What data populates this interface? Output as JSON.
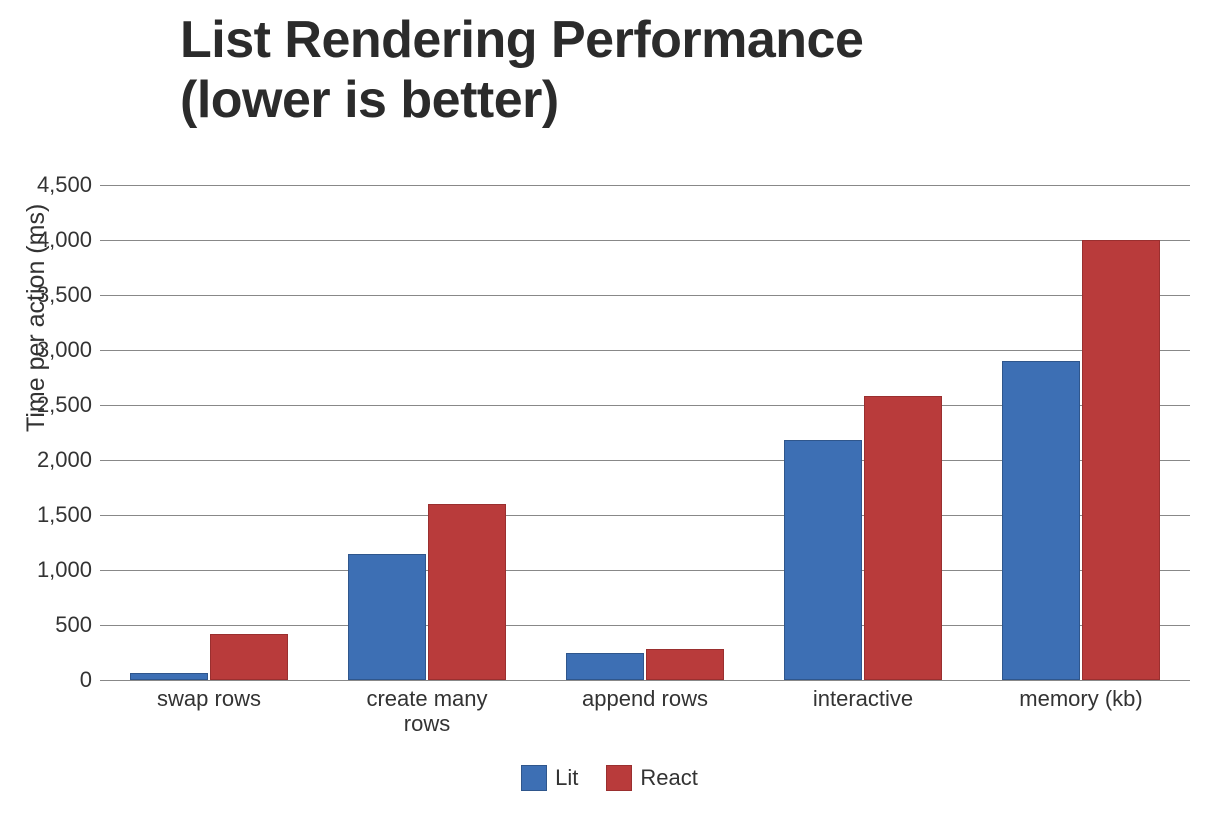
{
  "chart_data": {
    "type": "bar",
    "title_line1": "List Rendering Performance",
    "title_line2": "(lower is better)",
    "xlabel": "",
    "ylabel": "Time per action (ms)",
    "ylim": [
      0,
      4500
    ],
    "y_ticks": [
      0,
      500,
      1000,
      1500,
      2000,
      2500,
      3000,
      3500,
      4000,
      4500
    ],
    "y_tick_labels": [
      "0",
      "500",
      "1,000",
      "1,500",
      "2,000",
      "2,500",
      "3,000",
      "3,500",
      "4,000",
      "4,500"
    ],
    "categories": [
      "swap rows",
      "create many rows",
      "append rows",
      "interactive",
      "memory (kb)"
    ],
    "category_labels_html": [
      "swap rows",
      "create many<br>rows",
      "append rows",
      "interactive",
      "memory (kb)"
    ],
    "series": [
      {
        "name": "Lit",
        "class": "bar-lit",
        "values": [
          60,
          1150,
          250,
          2180,
          2900
        ]
      },
      {
        "name": "React",
        "class": "bar-react",
        "values": [
          420,
          1600,
          280,
          2580,
          4000
        ]
      }
    ],
    "legend": [
      "Lit",
      "React"
    ],
    "colors": {
      "Lit": "#3d6fb4",
      "React": "#b93b3b"
    }
  }
}
